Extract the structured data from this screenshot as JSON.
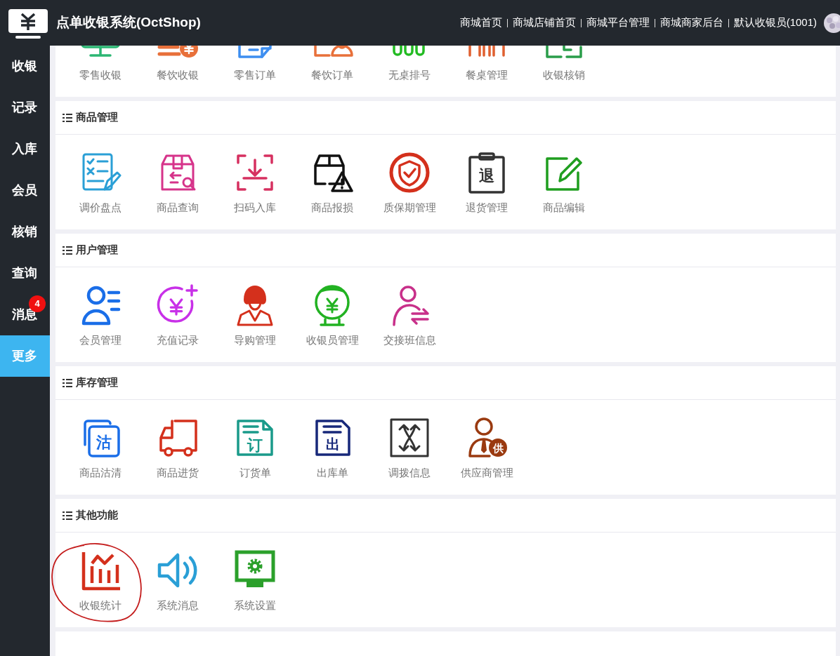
{
  "header": {
    "title": "点单收银系统(OctShop)",
    "links": [
      "商城首页",
      "商城店铺首页",
      "商城平台管理",
      "商城商家后台",
      "默认收银员(1001)"
    ]
  },
  "sidebar": {
    "items": [
      {
        "label": "收银",
        "selected": false
      },
      {
        "label": "记录",
        "selected": false
      },
      {
        "label": "入库",
        "selected": false
      },
      {
        "label": "会员",
        "selected": false
      },
      {
        "label": "核销",
        "selected": false
      },
      {
        "label": "查询",
        "selected": false
      },
      {
        "label": "消息",
        "selected": false,
        "badge": "4"
      },
      {
        "label": "更多",
        "selected": true
      }
    ]
  },
  "sections": [
    {
      "items": [
        {
          "label": "零售收银"
        },
        {
          "label": "餐饮收银"
        },
        {
          "label": "零售订单"
        },
        {
          "label": "餐饮订单"
        },
        {
          "label": "无桌排号"
        },
        {
          "label": "餐桌管理"
        },
        {
          "label": "收银核销"
        }
      ]
    },
    {
      "title": "商品管理",
      "items": [
        {
          "label": "调价盘点"
        },
        {
          "label": "商品查询"
        },
        {
          "label": "扫码入库"
        },
        {
          "label": "商品报损"
        },
        {
          "label": "质保期管理"
        },
        {
          "label": "退货管理",
          "glyph": "退"
        },
        {
          "label": "商品编辑"
        }
      ]
    },
    {
      "title": "用户管理",
      "items": [
        {
          "label": "会员管理"
        },
        {
          "label": "充值记录"
        },
        {
          "label": "导购管理"
        },
        {
          "label": "收银员管理"
        },
        {
          "label": "交接班信息"
        }
      ]
    },
    {
      "title": "库存管理",
      "items": [
        {
          "label": "商品沽清",
          "glyph": "沽"
        },
        {
          "label": "商品进货"
        },
        {
          "label": "订货单",
          "glyph": "订"
        },
        {
          "label": "出库单",
          "glyph": "出"
        },
        {
          "label": "调拨信息"
        },
        {
          "label": "供应商管理",
          "glyph": "供"
        }
      ]
    },
    {
      "title": "其他功能",
      "items": [
        {
          "label": "收银统计",
          "circled": true
        },
        {
          "label": "系统消息"
        },
        {
          "label": "系统设置"
        }
      ]
    }
  ]
}
